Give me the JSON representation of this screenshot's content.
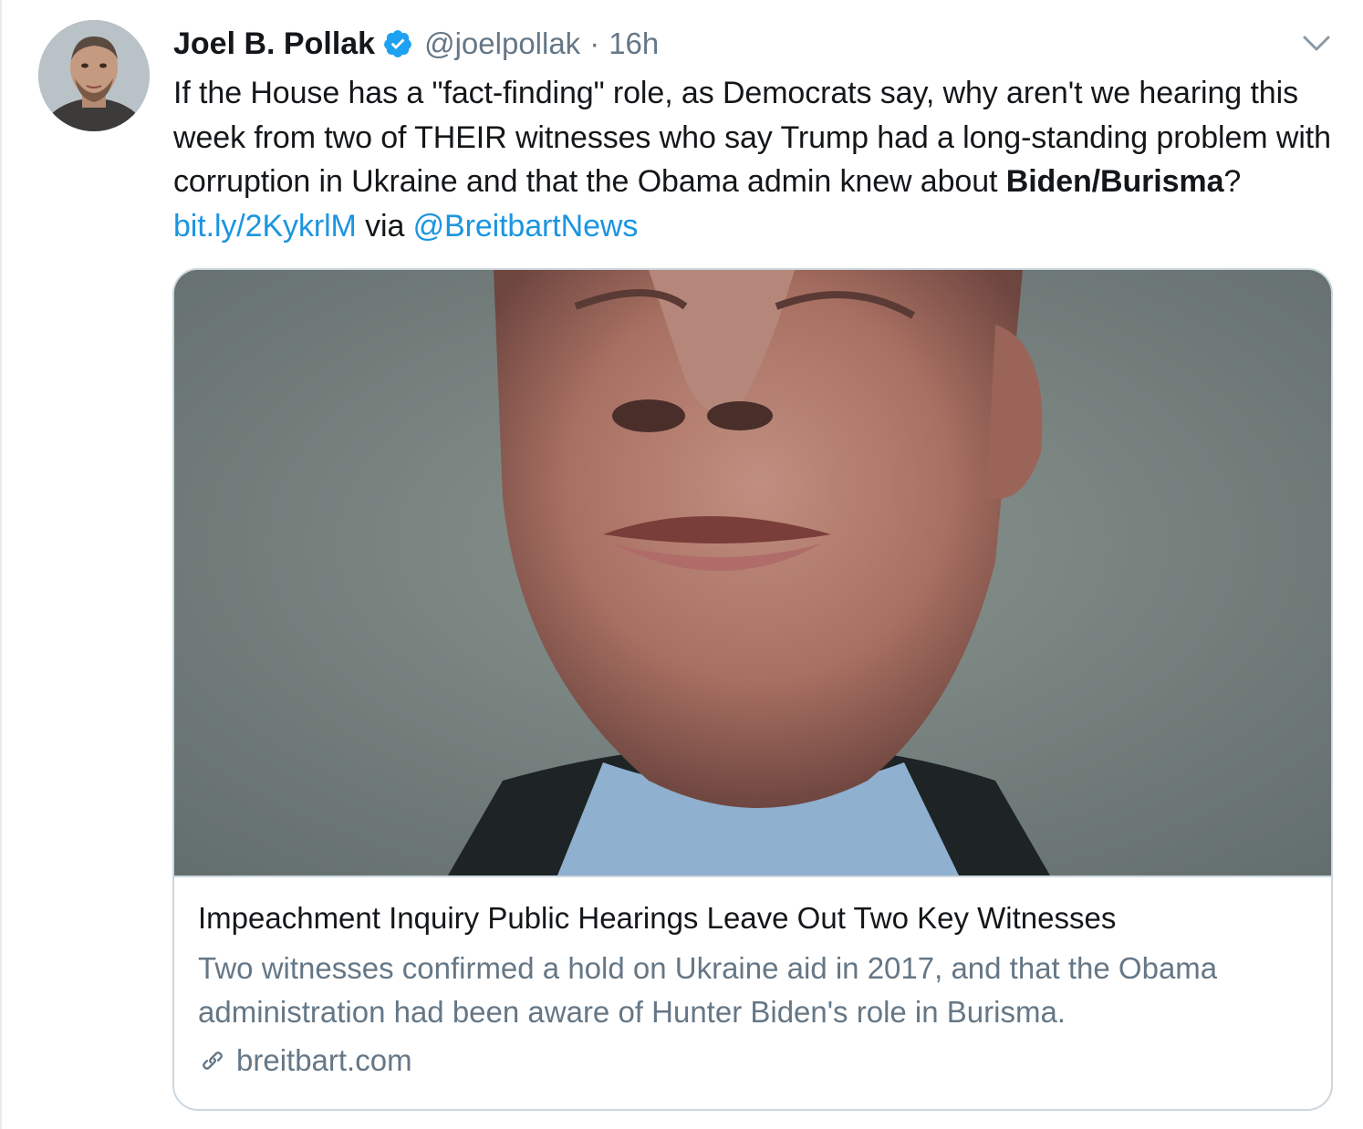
{
  "author": {
    "display_name": "Joel B. Pollak",
    "handle": "@joelpollak",
    "separator": "·",
    "time": "16h"
  },
  "tweet": {
    "text_1": "If the House has a \"fact-finding\" role, as Democrats say, why aren't we hearing this week from two of THEIR witnesses who say Trump had a long-standing problem with corruption in Ukraine and that the Obama admin knew about ",
    "bold": "Biden/Burisma",
    "text_2": "? ",
    "link": "bit.ly/2KykrlM",
    "text_3": " via ",
    "mention": "@BreitbartNews"
  },
  "card": {
    "title": "Impeachment Inquiry Public Hearings Leave Out Two Key Witnesses",
    "description": "Two witnesses confirmed a hold on Ukraine aid in 2017, and that the Obama administration had been aware of Hunter Biden's role in Burisma.",
    "domain": "breitbart.com"
  },
  "icons": {
    "verified": "verified-badge-icon",
    "menu": "chevron-down-icon",
    "domain_link": "link-icon"
  },
  "colors": {
    "link": "#1b95e0",
    "secondary_text": "#657786",
    "border": "#ccd6dd"
  }
}
